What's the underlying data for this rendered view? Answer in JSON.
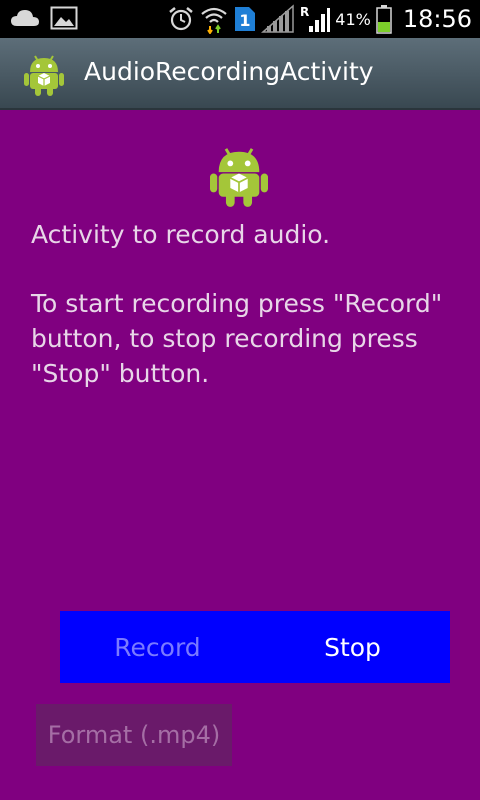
{
  "status_bar": {
    "icons_left": [
      "cloud-icon",
      "image-icon"
    ],
    "icons_right": [
      "alarm-icon",
      "wifi-icon",
      "sim-1-icon",
      "no-signal-icon",
      "roaming-signal-icon",
      "battery-icon"
    ],
    "sim_label": "1",
    "roaming_label": "R",
    "battery_percent": "41%",
    "battery_level": 0.41,
    "time": "18:56"
  },
  "action_bar": {
    "title": "AudioRecordingActivity",
    "icon": "android-app-icon"
  },
  "content": {
    "logo_icon": "android-logo-icon",
    "text_1": "Activity to record audio.",
    "text_2": "To start recording press \"Record\" button, to stop recording press \"Stop\" button."
  },
  "buttons": {
    "record_label": "Record",
    "stop_label": "Stop",
    "format_label": "Format (.mp4)"
  },
  "colors": {
    "background": "#800080",
    "action_bar": "#4a5a65",
    "button_bar": "#0000ff",
    "record_text_disabled": "#7a7aff",
    "stop_text": "#ffffff",
    "format_button_bg": "#6a1a6a",
    "battery_green": "#7ccf2a"
  }
}
